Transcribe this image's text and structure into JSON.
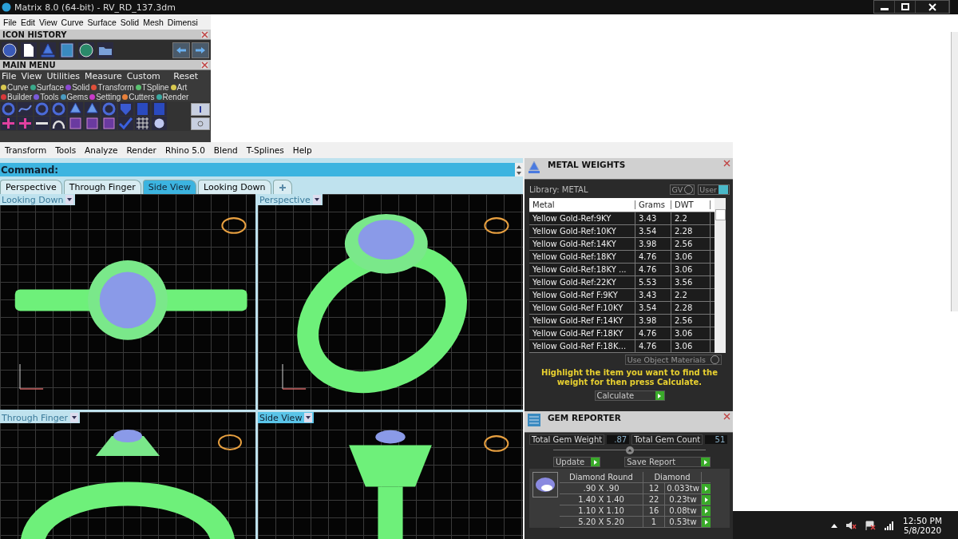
{
  "window": {
    "title": "Matrix 8.0 (64-bit) - RV_RD_137.3dm"
  },
  "menu_bar": [
    "File",
    "Edit",
    "View",
    "Curve",
    "Surface",
    "Solid",
    "Mesh",
    "Dimensi"
  ],
  "icon_history": {
    "title": "ICON HISTORY"
  },
  "main_menu": {
    "title": "MAIN MENU",
    "menu": [
      "File",
      "View",
      "Utilities",
      "Measure",
      "Custom"
    ],
    "reset": "Reset",
    "categories": [
      {
        "label": "Curve",
        "color": "#d8c850"
      },
      {
        "label": "Surface",
        "color": "#3aa88a"
      },
      {
        "label": "Solid",
        "color": "#8a4ad0"
      },
      {
        "label": "Transform",
        "color": "#e0503a"
      },
      {
        "label": "TSpline",
        "color": "#5ac070"
      },
      {
        "label": "Art",
        "color": "#d8c850"
      },
      {
        "label": "Builder",
        "color": "#d83a3a"
      },
      {
        "label": "Tools",
        "color": "#7a5ad8"
      },
      {
        "label": "Gems",
        "color": "#4a9ac0"
      },
      {
        "label": "Setting",
        "color": "#c83ac8"
      },
      {
        "label": "Cutters",
        "color": "#e8803a"
      },
      {
        "label": "Render",
        "color": "#3aa8a0"
      }
    ]
  },
  "rhino_menu": [
    "Transform",
    "Tools",
    "Analyze",
    "Render",
    "Rhino 5.0",
    "Blend",
    "T-Splines",
    "Help"
  ],
  "command": {
    "label": "Command:"
  },
  "tabs": [
    {
      "label": "Perspective",
      "selected": false
    },
    {
      "label": "Through Finger",
      "selected": false
    },
    {
      "label": "Side View",
      "selected": true
    },
    {
      "label": "Looking Down",
      "selected": false
    }
  ],
  "viewports": [
    {
      "label": "Looking Down",
      "kind": "top",
      "selected": false
    },
    {
      "label": "Perspective",
      "kind": "perspective",
      "selected": false
    },
    {
      "label": "Through Finger",
      "kind": "front",
      "selected": false
    },
    {
      "label": "Side View",
      "kind": "side",
      "selected": true
    }
  ],
  "metal_weights": {
    "title": "METAL WEIGHTS",
    "library": "Library: METAL",
    "toggles": [
      {
        "label": "GV",
        "on": false
      },
      {
        "label": "User",
        "on": true
      }
    ],
    "columns": [
      "Metal",
      "Grams",
      "DWT"
    ],
    "rows": [
      [
        "Yellow Gold-Ref:9KY",
        "3.43",
        "2.2"
      ],
      [
        "Yellow Gold-Ref:10KY",
        "3.54",
        "2.28"
      ],
      [
        "Yellow Gold-Ref:14KY",
        "3.98",
        "2.56"
      ],
      [
        "Yellow Gold-Ref:18KY",
        "4.76",
        "3.06"
      ],
      [
        "Yellow Gold-Ref:18KY ...",
        "4.76",
        "3.06"
      ],
      [
        "Yellow Gold-Ref:22KY",
        "5.53",
        "3.56"
      ],
      [
        "Yellow Gold-Ref F:9KY",
        "3.43",
        "2.2"
      ],
      [
        "Yellow Gold-Ref F:10KY",
        "3.54",
        "2.28"
      ],
      [
        "Yellow Gold-Ref F:14KY",
        "3.98",
        "2.56"
      ],
      [
        "Yellow Gold-Ref F:18KY",
        "4.76",
        "3.06"
      ],
      [
        "Yellow Gold-Ref F:18K...",
        "4.76",
        "3.06"
      ]
    ],
    "use_object_materials": "Use Object Materials",
    "hint": "Highlight the item you want to find the weight for then press Calculate.",
    "calculate": "Calculate"
  },
  "gem_reporter": {
    "title": "GEM REPORTER",
    "weight_label": "Total Gem Weight",
    "weight": ".87",
    "count_label": "Total Gem Count",
    "count": "51",
    "update": "Update",
    "save_report": "Save Report",
    "columns": [
      "Diamond Round",
      "Diamond"
    ],
    "rows": [
      [
        ".90 X .90",
        "12",
        "0.033tw"
      ],
      [
        "1.40 X 1.40",
        "22",
        "0.23tw"
      ],
      [
        "1.10 X 1.10",
        "16",
        "0.08tw"
      ],
      [
        "5.20 X 5.20",
        "1",
        "0.53tw"
      ]
    ]
  },
  "taskbar": {
    "time": "12:50 PM",
    "date": "5/8/2020"
  }
}
